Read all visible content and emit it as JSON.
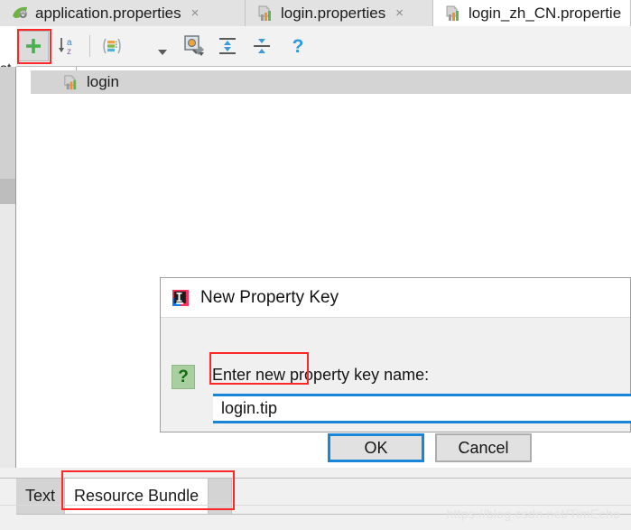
{
  "window": {
    "left_gutter_fragment": "st"
  },
  "editor_tabs": [
    {
      "label": "application.properties",
      "icon": "spring-leaf-icon",
      "close": "×",
      "active": false
    },
    {
      "label": "login.properties",
      "icon": "resource-bundle-icon",
      "close": "×",
      "active": false
    },
    {
      "label": "login_zh_CN.propertie",
      "icon": "resource-bundle-icon",
      "close": "",
      "active": true
    }
  ],
  "toolbar": {
    "buttons": [
      {
        "name": "add-property-button",
        "icon": "plus-icon",
        "label": "+",
        "pressed": true
      },
      {
        "name": "sort-az-button",
        "icon": "sort-alphabetical-icon",
        "label": "↓az",
        "pressed": false
      },
      {
        "name": "group-by-button",
        "icon": "group-list-icon",
        "label": "group",
        "pressed": false
      },
      {
        "name": "dropdown-button",
        "icon": "chevron-down-icon",
        "label": "▾",
        "pressed": false
      },
      {
        "name": "settings-button",
        "icon": "settings-wrench-icon",
        "label": "settings",
        "pressed": false
      },
      {
        "name": "expand-all-button",
        "icon": "expand-all-icon",
        "label": "expand",
        "pressed": false
      },
      {
        "name": "collapse-all-button",
        "icon": "collapse-all-icon",
        "label": "collapse",
        "pressed": false
      },
      {
        "name": "help-button",
        "icon": "question-mark-icon",
        "label": "?",
        "pressed": false
      }
    ]
  },
  "tree": {
    "rows": [
      {
        "label": "login",
        "icon": "resource-bundle-icon",
        "selected": true
      }
    ]
  },
  "dialog": {
    "icon": "intellij-idea-logo-icon",
    "title": "New Property Key",
    "help_icon": "question-mark-icon",
    "help_glyph": "?",
    "prompt": "Enter new property key name:",
    "input_value": "login.tip",
    "input_placeholder": "",
    "ok_label": "OK",
    "cancel_label": "Cancel"
  },
  "bottom_tabs": [
    {
      "label": "Text",
      "active": false
    },
    {
      "label": "Resource Bundle",
      "active": true
    }
  ],
  "watermark": "https://blog.csdn.net/TimEcho",
  "colors": {
    "accent_blue": "#1a85d6",
    "annotation_red": "#fb2828",
    "tab_bar": "#e2e2e2",
    "dialog_bg": "#f0f0f0",
    "selection_gray": "#d4d4d4",
    "help_green": "#a9cfa0"
  }
}
